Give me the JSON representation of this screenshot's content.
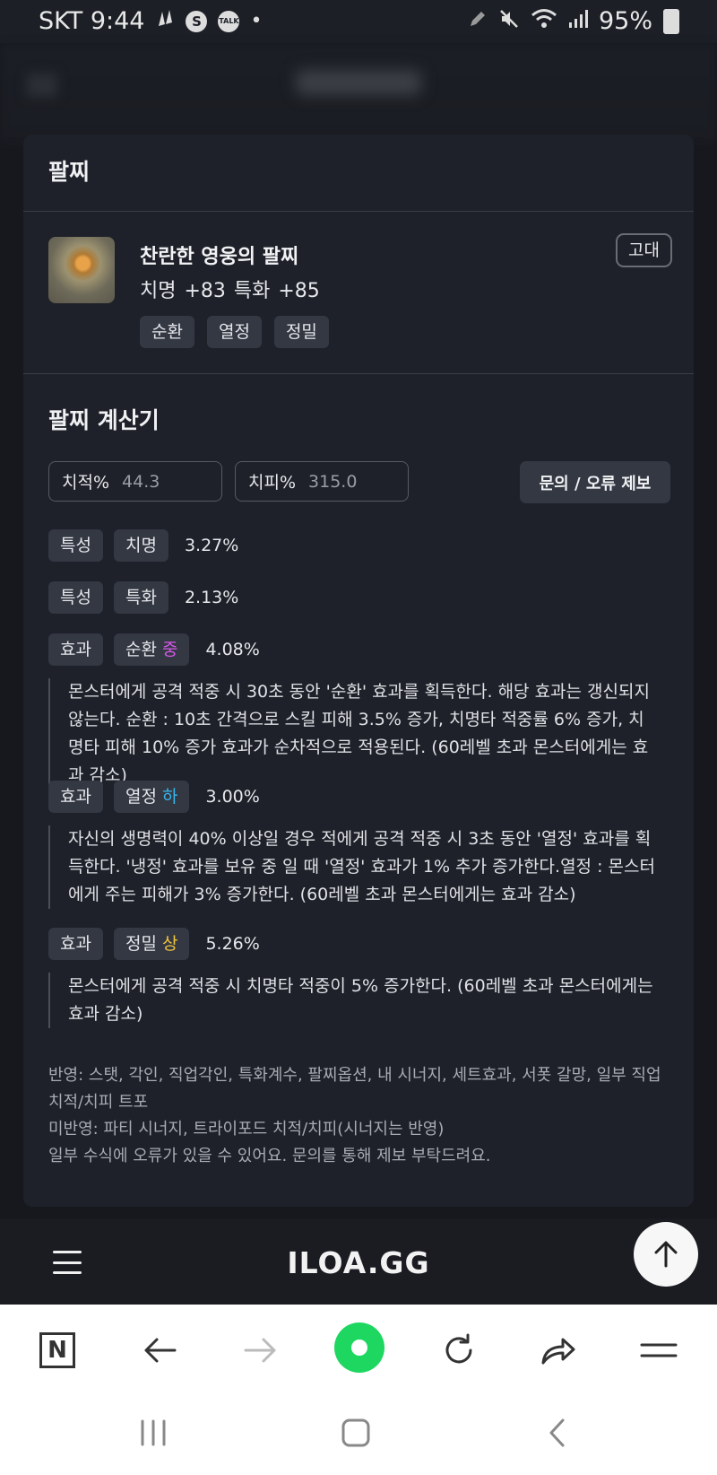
{
  "status_bar": {
    "carrier_time": "SKT 9:44",
    "battery": "95%",
    "app_icons": [
      "notification-icon",
      "s-app-icon",
      "talk-icon",
      "dot-icon"
    ],
    "status_icons": [
      "pen-icon",
      "mute-icon",
      "wifi-icon",
      "signal-icon",
      "battery-icon"
    ],
    "talk_label": "TALK",
    "s_label": "S"
  },
  "card": {
    "section_title": "팔찌",
    "item": {
      "name": "찬란한 영웅의 팔찌",
      "stats": "치명 +83  특화 +85",
      "grade": "고대",
      "tags": [
        "순환",
        "열정",
        "정밀"
      ]
    },
    "calculator": {
      "title": "팔찌 계산기",
      "crit_rate": {
        "label": "치적%",
        "value": "44.3"
      },
      "crit_dmg": {
        "label": "치피%",
        "value": "315.0"
      },
      "report_button": "문의 / 오류 제보",
      "rows": [
        {
          "type": "특성",
          "name": "치명",
          "grade": "",
          "value": "3.27%"
        },
        {
          "type": "특성",
          "name": "특화",
          "grade": "",
          "value": "2.13%"
        },
        {
          "type": "효과",
          "name": "순환",
          "grade": "중",
          "value": "4.08%",
          "description": "몬스터에게 공격 적중 시 30초 동안 '순환' 효과를 획득한다. 해당 효과는 갱신되지 않는다. 순환 : 10초 간격으로 스킬 피해 3.5% 증가, 치명타 적중률 6% 증가, 치명타 피해 10% 증가 효과가 순차적으로 적용된다. (60레벨 초과 몬스터에게는 효과 감소)"
        },
        {
          "type": "효과",
          "name": "열정",
          "grade": "하",
          "value": "3.00%",
          "description": "자신의 생명력이 40% 이상일 경우 적에게 공격 적중 시 3초 동안 '열정' 효과를 획득한다. '냉정' 효과를 보유 중 일 때 '열정' 효과가 1% 추가 증가한다.열정 : 몬스터에게 주는 피해가 3% 증가한다. (60레벨 초과 몬스터에게는 효과 감소)"
        },
        {
          "type": "효과",
          "name": "정밀",
          "grade": "상",
          "value": "5.26%",
          "description": "몬스터에게 공격 적중 시 치명타 적중이 5% 증가한다. (60레벨 초과 몬스터에게는 효과 감소)"
        }
      ],
      "notes": [
        "반영: 스탯, 각인, 직업각인, 특화계수, 팔찌옵션, 내 시너지, 세트효과, 서폿 갈망, 일부 직업 치적/치피 트포",
        "미반영: 파티 시너지, 트라이포드 치적/치피(시너지는 반영)",
        "일부 수식에 오류가 있을 수 있어요. 문의를 통해 제보 부탁드려요."
      ]
    }
  },
  "site": {
    "logo": "ILOA.GG"
  },
  "colors": {
    "grade_mid": "#d458e6",
    "grade_low": "#36b7ee",
    "grade_high": "#f1c33b",
    "accent_green": "#1ed760"
  }
}
